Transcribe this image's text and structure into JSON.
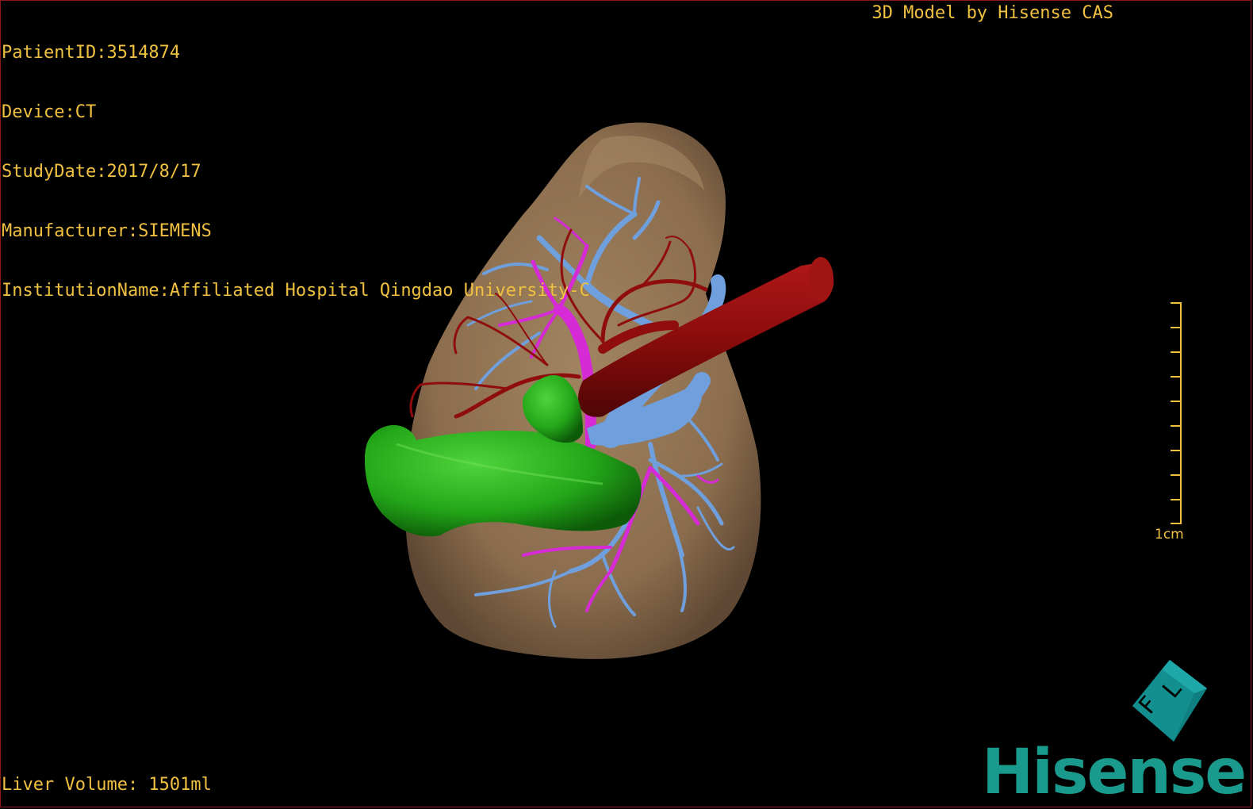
{
  "study_info": {
    "patient_id": "PatientID:3514874",
    "device": "Device:CT",
    "study_date": "StudyDate:2017/8/17",
    "manufacturer": "Manufacturer:SIEMENS",
    "institution": "InstitutionName:Affiliated Hospital Qingdao University-C"
  },
  "model_credit": "3D Model by Hisense CAS",
  "liver_volume": "Liver Volume: 1501ml",
  "scale_label": "1cm",
  "orientation_cube": {
    "labels": [
      "F",
      "L"
    ]
  },
  "brand": "Hisense",
  "colors": {
    "hud_text": "#f0c040",
    "liver": "#8b6d4e",
    "portal_vein": "#6f9fdc",
    "hepatic_artery": "#8f0d0d",
    "bile_duct": "#d52ad5",
    "gallbladder_duodenum": "#1f9a18",
    "brand": "#1a9a8c"
  }
}
